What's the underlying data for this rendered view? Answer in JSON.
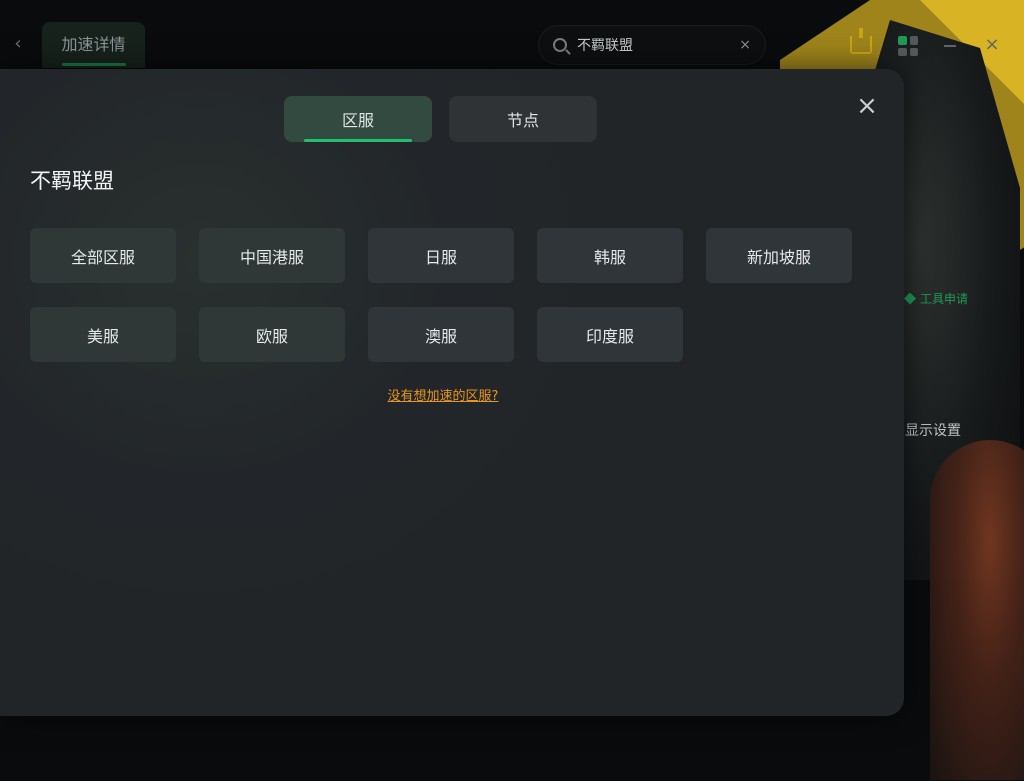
{
  "topbar": {
    "back_icon": "chevron-left-icon",
    "tab_label": "加速详情",
    "search_value": "不羁联盟",
    "search_clear": "×",
    "minimize": "—",
    "close": "×"
  },
  "background": {
    "tool_apply": "工具申请",
    "display_settings": "显示设置"
  },
  "modal": {
    "close": "×",
    "tabs": [
      {
        "label": "区服",
        "active": true
      },
      {
        "label": "节点",
        "active": false
      }
    ],
    "title": "不羁联盟",
    "regions": [
      "全部区服",
      "中国港服",
      "日服",
      "韩服",
      "新加坡服",
      "美服",
      "欧服",
      "澳服",
      "印度服"
    ],
    "missing_link": "没有想加速的区服?"
  },
  "colors": {
    "accent_green": "#22c06a",
    "link_orange": "#e8951e",
    "modal_bg": "#222528"
  }
}
